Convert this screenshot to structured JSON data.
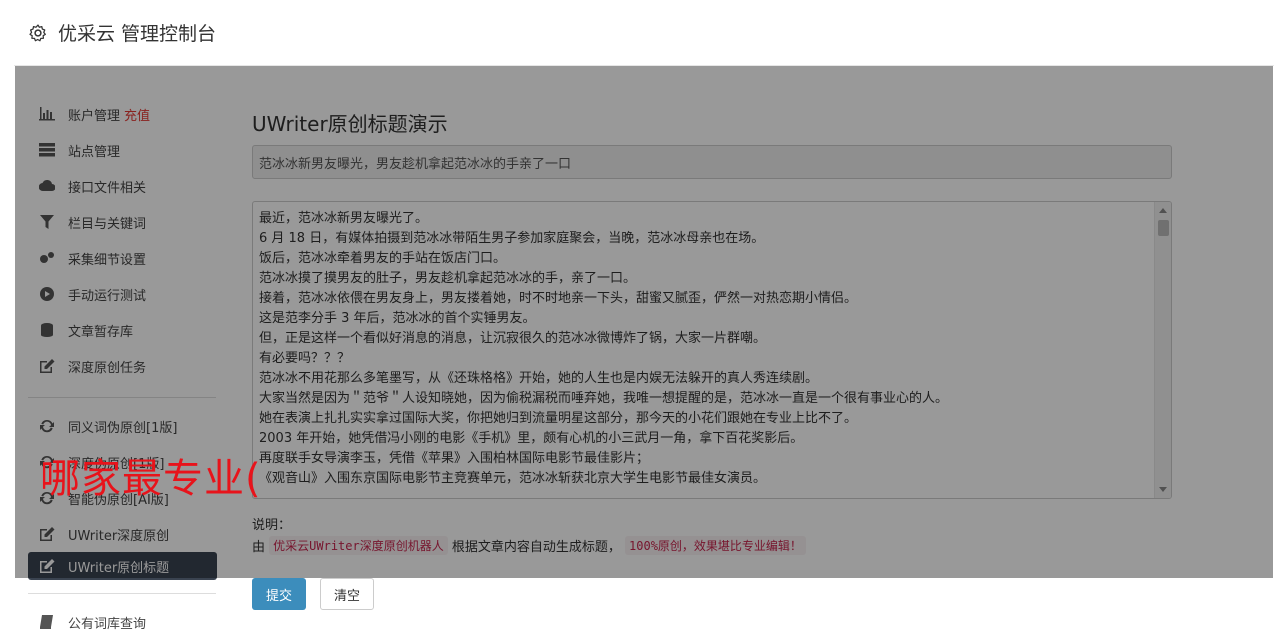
{
  "header": {
    "title": "优采云 管理控制台",
    "icon": "gear-icon"
  },
  "sidebar": {
    "group1": [
      {
        "label": "账户管理",
        "extra": "充值",
        "icon": "bar-chart-icon"
      },
      {
        "label": "站点管理",
        "icon": "server-icon"
      },
      {
        "label": "接口文件相关",
        "icon": "cloud-upload-icon"
      },
      {
        "label": "栏目与关键词",
        "icon": "filter-icon"
      },
      {
        "label": "采集细节设置",
        "icon": "cogs-icon"
      },
      {
        "label": "手动运行测试",
        "icon": "play-circle-icon"
      },
      {
        "label": "文章暂存库",
        "icon": "database-icon"
      },
      {
        "label": "深度原创任务",
        "icon": "edit-icon"
      }
    ],
    "group2": [
      {
        "label": "同义词伪原创[1版]",
        "icon": "refresh-icon"
      },
      {
        "label": "深度伪原创[1版]",
        "icon": "refresh-icon"
      },
      {
        "label": "智能伪原创[AI版]",
        "icon": "refresh-icon"
      },
      {
        "label": "UWriter深度原创",
        "icon": "edit-icon"
      },
      {
        "label": "UWriter原创标题",
        "icon": "edit-icon",
        "active": true
      }
    ],
    "group3": [
      {
        "label": "公有词库查询",
        "icon": "book-icon"
      }
    ]
  },
  "main": {
    "heading": "UWriter原创标题演示",
    "title_value": "范冰冰新男友曝光，男友趁机拿起范冰冰的手亲了一口",
    "content_lines": [
      "最近，范冰冰新男友曝光了。",
      "6 月 18 日，有媒体拍摄到范冰冰带陌生男子参加家庭聚会，当晚，范冰冰母亲也在场。",
      "饭后，范冰冰牵着男友的手站在饭店门口。",
      "范冰冰摸了摸男友的肚子，男友趁机拿起范冰冰的手，亲了一口。",
      "接着，范冰冰依偎在男友身上，男友搂着她，时不时地亲一下头，甜蜜又腻歪，俨然一对热恋期小情侣。",
      "这是范李分手 3 年后，范冰冰的首个实锤男友。",
      "但，正是这样一个看似好消息的消息，让沉寂很久的范冰冰微博炸了锅，大家一片群嘲。",
      "有必要吗？？？",
      "范冰冰不用花那么多笔墨写，从《还珠格格》开始，她的人生也是内娱无法躲开的真人秀连续剧。",
      "大家当然是因为＂范爷＂人设知晓她，因为偷税漏税而唾弃她，我唯一想提醒的是，范冰冰一直是一个很有事业心的人。",
      "她在表演上扎扎实实拿过国际大奖，你把她归到流量明星这部分，那今天的小花们跟她在专业上比不了。",
      "2003 年开始，她凭借冯小刚的电影《手机》里，颇有心机的小三武月一角，拿下百花奖影后。",
      "再度联手女导演李玉，凭借《苹果》入围柏林国际电影节最佳影片；",
      "《观音山》入围东京国际电影节主竞赛单元，范冰冰斩获北京大学生电影节最佳女演员。"
    ],
    "note_label": "说明：",
    "note_prefix": "由",
    "note_code1": "优采云UWriter深度原创机器人",
    "note_middle": "根据文章内容自动生成标题，",
    "note_code2": "100%原创，效果堪比专业编辑！",
    "submit_label": "提交",
    "clear_label": "清空"
  },
  "watermark": "哪家最专业(",
  "colors": {
    "accent": "#3c8dbc",
    "active_bg": "#3a4350",
    "watermark": "#e8131b",
    "code": "#c7254e"
  }
}
